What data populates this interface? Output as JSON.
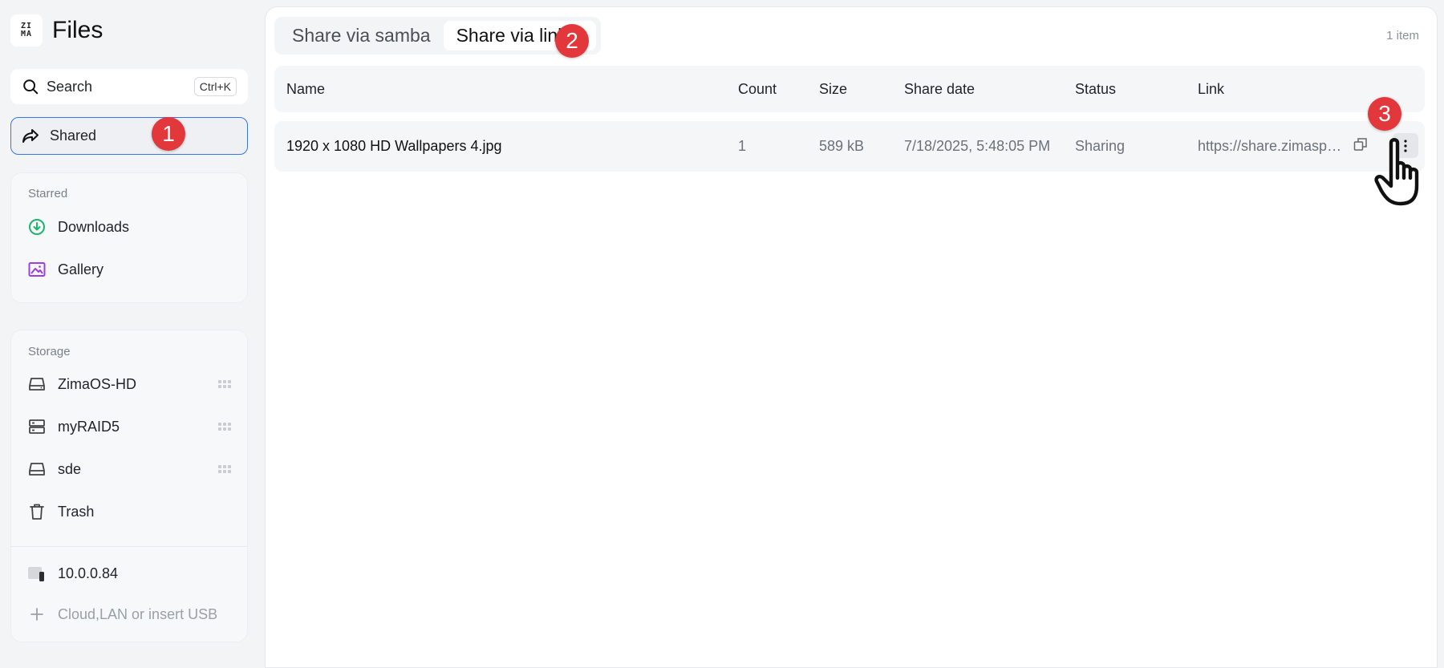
{
  "app": {
    "logo_top": "ZI",
    "logo_bottom": "MA",
    "title": "Files"
  },
  "search": {
    "label": "Search",
    "shortcut": "Ctrl+K"
  },
  "nav": {
    "shared_label": "Shared"
  },
  "starred": {
    "title": "Starred",
    "items": [
      {
        "label": "Downloads",
        "icon": "download-circle-icon",
        "color": "#1fb46b"
      },
      {
        "label": "Gallery",
        "icon": "image-icon",
        "color": "#9b3fe0"
      }
    ]
  },
  "storage": {
    "title": "Storage",
    "items": [
      {
        "label": "ZimaOS-HD",
        "icon": "drive-icon"
      },
      {
        "label": "myRAID5",
        "icon": "server-icon"
      },
      {
        "label": "sde",
        "icon": "drive-icon"
      },
      {
        "label": "Trash",
        "icon": "trash-icon"
      }
    ],
    "device_label": "10.0.0.84",
    "add_label": "Cloud,LAN or insert USB"
  },
  "main": {
    "tabs": [
      {
        "label": "Share via samba",
        "active": false
      },
      {
        "label": "Share via link",
        "active": true
      }
    ],
    "item_count": "1 item",
    "columns": [
      "Name",
      "Count",
      "Size",
      "Share date",
      "Status",
      "Link"
    ],
    "rows": [
      {
        "name": "1920 x 1080 HD Wallpapers 4.jpg",
        "count": "1",
        "size": "589 kB",
        "share_date": "7/18/2025, 5:48:05 PM",
        "status": "Sharing",
        "link": "https://share.zimaspac..."
      }
    ]
  },
  "annotations": {
    "step1": "1",
    "step2": "2",
    "step3": "3",
    "color": "#e2373b"
  }
}
